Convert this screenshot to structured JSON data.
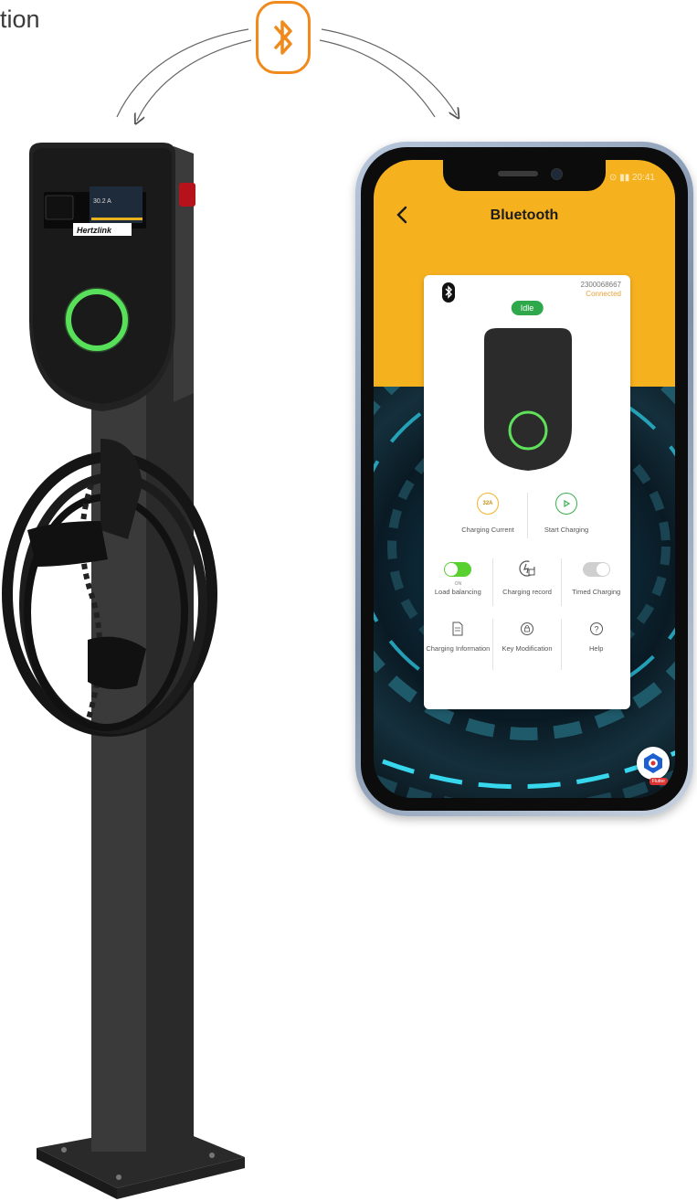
{
  "caption": {
    "text": "tion"
  },
  "bluetooth_badge": {
    "icon": "bluetooth-icon",
    "color": "#f08a1c"
  },
  "charger": {
    "brand": "Hertzlink",
    "display_reading": "30.2 A",
    "ring_color": "#58e05a"
  },
  "phone": {
    "status_text": "⊙ ▮▮ 20:41",
    "app": {
      "title": "Bluetooth",
      "back_icon": "chevron-left-icon",
      "card": {
        "serial": "2300068667",
        "connection": "Connected",
        "status_badge": "Idle",
        "actions": [
          {
            "label": "Charging Current",
            "icon_text": "32A"
          },
          {
            "label": "Start Charging",
            "icon": "play-icon"
          }
        ],
        "toggles": [
          {
            "label": "Load balancing",
            "sub": "ON",
            "state": "on"
          },
          {
            "label": "Charging record",
            "icon": "charging-record-icon"
          },
          {
            "label": "Timed Charging",
            "state": "off"
          }
        ],
        "menu": [
          {
            "label": "Charging Information",
            "icon": "document-icon"
          },
          {
            "label": "Key Modification",
            "icon": "lock-icon"
          },
          {
            "label": "Help",
            "icon": "question-icon"
          }
        ]
      },
      "badge": {
        "label": "Flutter"
      }
    }
  },
  "colors": {
    "accent": "#f6b11f",
    "active": "#2ea84b",
    "toggle_on": "#58d030"
  }
}
